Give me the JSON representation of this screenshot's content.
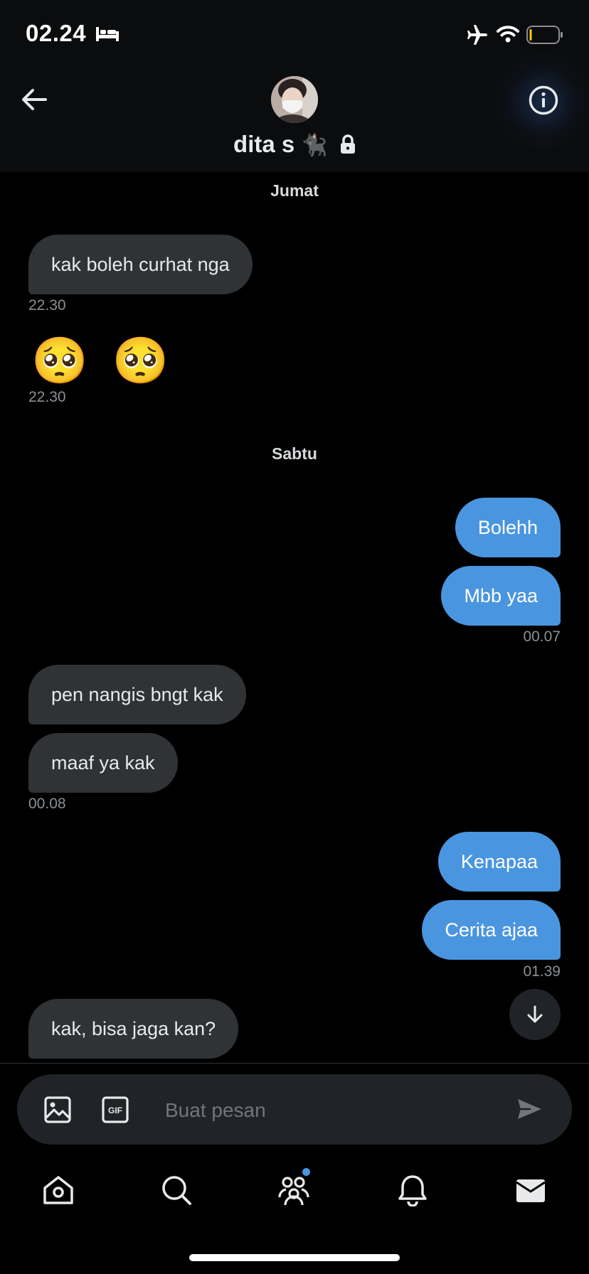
{
  "status_bar": {
    "time": "02.24",
    "icons": [
      "bed-icon",
      "airplane-icon",
      "wifi-icon",
      "battery-icon"
    ]
  },
  "header": {
    "name": "dita s",
    "name_emoji": "🐈‍⬛",
    "icons": [
      "back-arrow-icon",
      "lock-icon",
      "info-icon"
    ]
  },
  "conversation": {
    "day_1": "Jumat",
    "day_2": "Sabtu",
    "messages": [
      {
        "side": "in",
        "text": "kak boleh curhat nga",
        "time": "22.30"
      },
      {
        "side": "in",
        "text": "🥺 🥺",
        "time": "22.30"
      },
      {
        "side": "out",
        "text": "Bolehh"
      },
      {
        "side": "out",
        "text": "Mbb yaa",
        "time": "00.07"
      },
      {
        "side": "in",
        "text": "pen nangis bngt kak"
      },
      {
        "side": "in",
        "text": "maaf ya kak",
        "time": "00.08"
      },
      {
        "side": "out",
        "text": "Kenapaa"
      },
      {
        "side": "out",
        "text": "Cerita ajaa",
        "time": "01.39"
      },
      {
        "side": "in",
        "text": "kak, bisa jaga kan?"
      }
    ]
  },
  "composer": {
    "placeholder": "Buat pesan",
    "gif_label": "GIF",
    "icons": [
      "image-icon",
      "gif-icon",
      "send-icon"
    ]
  },
  "bottom_nav": {
    "items": [
      "home-icon",
      "search-icon",
      "communities-icon",
      "notifications-icon",
      "messages-icon"
    ],
    "badge_dot_color": "#4a95df"
  },
  "colors": {
    "background": "#000000",
    "incoming_bubble": "#2f3336",
    "outgoing_bubble": "#4a95df",
    "timestamp": "#8b9094"
  }
}
